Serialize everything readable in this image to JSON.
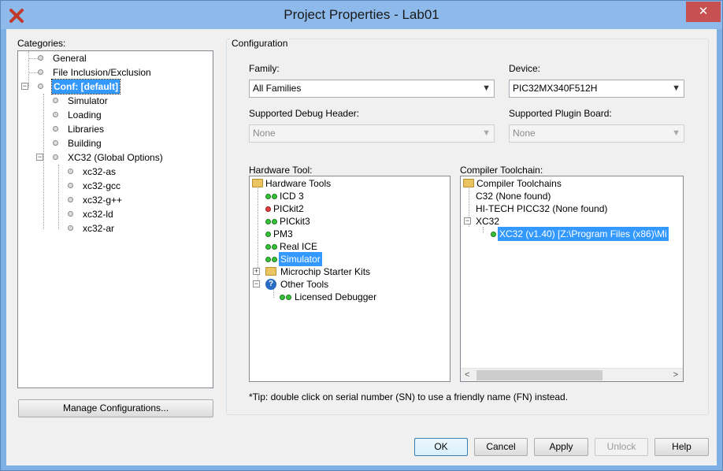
{
  "window": {
    "title": "Project Properties - Lab01",
    "close_label": "✕"
  },
  "categories": {
    "label": "Categories:",
    "items": [
      {
        "label": "General"
      },
      {
        "label": "File Inclusion/Exclusion"
      },
      {
        "label": "Conf: [default]"
      },
      {
        "label": "Simulator"
      },
      {
        "label": "Loading"
      },
      {
        "label": "Libraries"
      },
      {
        "label": "Building"
      },
      {
        "label": "XC32 (Global Options)"
      },
      {
        "label": "xc32-as"
      },
      {
        "label": "xc32-gcc"
      },
      {
        "label": "xc32-g++"
      },
      {
        "label": "xc32-ld"
      },
      {
        "label": "xc32-ar"
      }
    ],
    "manage_button": "Manage Configurations..."
  },
  "configuration": {
    "group_label": "Configuration",
    "family_label": "Family:",
    "family_value": "All Families",
    "device_label": "Device:",
    "device_value": "PIC32MX340F512H",
    "debug_header_label": "Supported Debug Header:",
    "debug_header_value": "None",
    "plugin_board_label": "Supported Plugin Board:",
    "plugin_board_value": "None",
    "hardware_tool_label": "Hardware Tool:",
    "hardware_tools": {
      "root": "Hardware Tools",
      "items": [
        {
          "label": "ICD 3",
          "status": "green"
        },
        {
          "label": "PICkit2",
          "status": "red"
        },
        {
          "label": "PICkit3",
          "status": "green"
        },
        {
          "label": "PM3",
          "status": "green"
        },
        {
          "label": "Real ICE",
          "status": "green"
        },
        {
          "label": "Simulator",
          "status": "green"
        }
      ],
      "starter_kits": "Microchip Starter Kits",
      "other_tools": "Other Tools",
      "licensed_debugger": "Licensed Debugger"
    },
    "compiler_toolchain_label": "Compiler Toolchain:",
    "compiler_toolchains": {
      "root": "Compiler Toolchains",
      "c32": "C32 (None found)",
      "hitech": "HI-TECH PICC32 (None found)",
      "xc32": "XC32",
      "xc32_version": "XC32 (v1.40) [Z:\\Program Files (x86)\\Mi"
    },
    "tip": "*Tip: double click on serial number (SN) to use a friendly name (FN) instead."
  },
  "buttons": {
    "ok": "OK",
    "cancel": "Cancel",
    "apply": "Apply",
    "unlock": "Unlock",
    "help": "Help"
  },
  "icons": {
    "app": "close-x-icon",
    "folder": "folder-icon",
    "status_green": "green-status-icon",
    "status_red": "red-status-icon",
    "question": "question-icon"
  },
  "colors": {
    "selection": "#3399ff",
    "titlebar": "#8dbaea",
    "close": "#c75050"
  }
}
